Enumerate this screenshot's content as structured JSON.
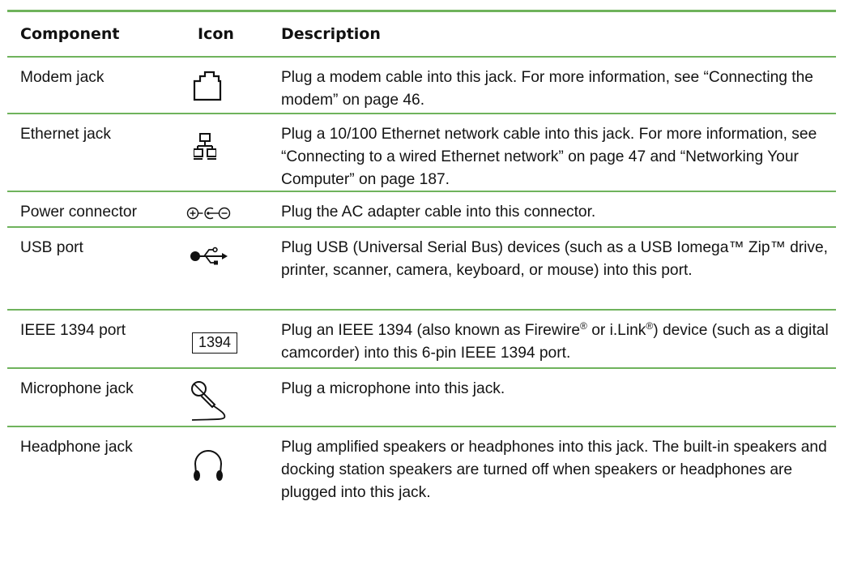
{
  "table": {
    "headers": {
      "component": "Component",
      "icon": "Icon",
      "description": "Description"
    },
    "rows": [
      {
        "component": "Modem jack",
        "icon": "modem-jack-icon",
        "description": "Plug a modem cable into this jack. For more information, see “Connecting the modem” on page 46."
      },
      {
        "component": "Ethernet jack",
        "icon": "network-icon",
        "description": "Plug a 10/100 Ethernet network cable into this jack. For more information, see “Connecting to a wired Ethernet network” on page 47 and “Networking Your Computer” on page 187."
      },
      {
        "component": "Power connector",
        "icon": "dc-power-icon",
        "description": "Plug the AC adapter cable into this connector."
      },
      {
        "component": "USB port",
        "icon": "usb-icon",
        "description": "Plug USB (Universal Serial Bus) devices (such as a USB Iomega™ Zip™ drive, printer, scanner, camera, keyboard, or mouse) into this port."
      },
      {
        "component": "IEEE 1394 port",
        "icon": "ieee1394-icon",
        "icon_text": "1394",
        "description_parts": {
          "before": "Plug an IEEE 1394 (also known as Firewire",
          "reg1": "®",
          "middle": " or i.Link",
          "reg2": "®",
          "after": ") device (such as a digital camcorder) into this 6-pin IEEE 1394 port."
        }
      },
      {
        "component": "Microphone jack",
        "icon": "microphone-icon",
        "description": "Plug a microphone into this jack."
      },
      {
        "component": "Headphone jack",
        "icon": "headphones-icon",
        "description": "Plug amplified speakers or headphones into this jack. The built-in speakers and docking station speakers are turned off when speakers or headphones are plugged into this jack."
      }
    ]
  },
  "colors": {
    "rule": "#6fb35c",
    "text": "#141414"
  }
}
